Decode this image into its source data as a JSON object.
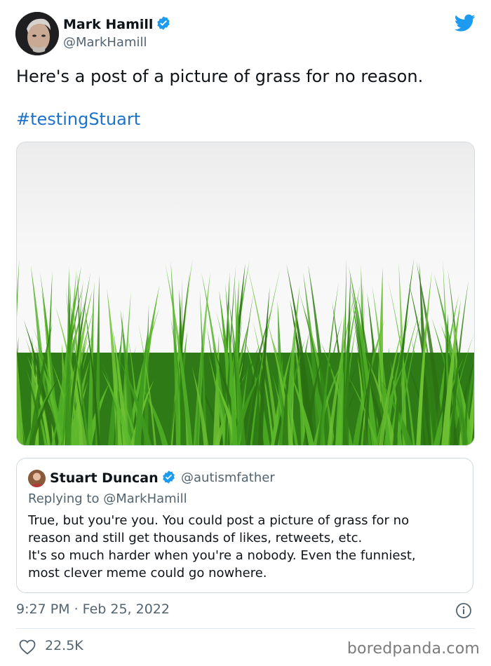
{
  "author": {
    "display_name": "Mark Hamill",
    "handle": "@MarkHamill",
    "verified": true
  },
  "tweet": {
    "text": "Here's a post of a picture of grass for no reason.",
    "hashtag": "#testingStuart"
  },
  "media": {
    "subject": "grass"
  },
  "quoted_tweet": {
    "display_name": "Stuart Duncan",
    "handle": "@autismfather",
    "verified": true,
    "replying_to": "Replying to @MarkHamill",
    "lines": [
      "True, but you're you. You could post a picture of grass for no",
      "reason and still get thousands of likes, retweets, etc.",
      "It's so much harder when you're a nobody. Even the funniest,",
      "most clever meme could go nowhere."
    ]
  },
  "footer": {
    "timestamp": "9:27 PM · Feb 25, 2022",
    "likes": "22.5K",
    "watermark": "boredpanda.com"
  },
  "colors": {
    "twitter_blue": "#1d9bf0",
    "hashtag_blue": "#1d72c9",
    "muted_text": "#536471",
    "grass_dark": "#2f7d14",
    "grass_light": "#6fc233"
  },
  "icons": [
    "verified-badge-icon",
    "twitter-bird-icon",
    "info-icon",
    "heart-icon"
  ]
}
